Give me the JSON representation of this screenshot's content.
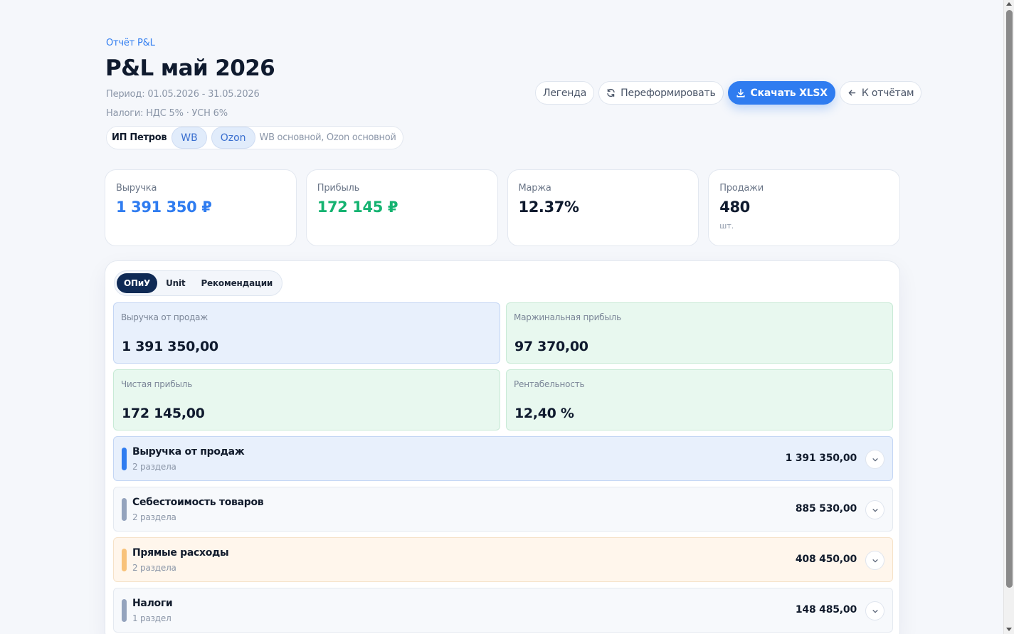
{
  "breadcrumb": "Отчёт P&L",
  "title": "P&L май 2026",
  "period": "Период: 01.05.2026 - 31.05.2026",
  "taxes": "Налоги: НДС 5% · УСН 6%",
  "entity": {
    "name": "ИП Петров",
    "chips": [
      "WB",
      "Ozon"
    ],
    "accounts": "WB основной, Ozon основной"
  },
  "actions": {
    "legend": "Легенда",
    "reform": "Переформировать",
    "download": "Скачать XLSX",
    "back": "К отчётам"
  },
  "kpis": [
    {
      "label": "Выручка",
      "value": "1 391 350 ₽",
      "color": "#2f7cf0"
    },
    {
      "label": "Прибыль",
      "value": "172 145 ₽",
      "color": "#15b371"
    },
    {
      "label": "Маржа",
      "value": "12.37%"
    },
    {
      "label": "Продажи",
      "value": "480",
      "unit": "шт."
    }
  ],
  "tabs": [
    "ОПиУ",
    "Unit",
    "Рекомендации"
  ],
  "active_tab": "ОПиУ",
  "summary": [
    {
      "label": "Выручка от продаж",
      "value": "1 391 350,00"
    },
    {
      "label": "Маржинальная прибыль",
      "value": "97 370,00"
    },
    {
      "label": "Чистая прибыль",
      "value": "172 145,00"
    },
    {
      "label": "Рентабельность",
      "value": "12,40 %"
    }
  ],
  "sections": [
    {
      "title": "Выручка от продаж",
      "subtitle": "2 раздела",
      "value": "1 391 350,00",
      "accent": "#2f7cf0"
    },
    {
      "title": "Себестоимость товаров",
      "subtitle": "2 раздела",
      "value": "885 530,00",
      "accent": "#94a3bd"
    },
    {
      "title": "Прямые расходы",
      "subtitle": "2 раздела",
      "value": "408 450,00",
      "accent": "#f8c27a"
    },
    {
      "title": "Налоги",
      "subtitle": "1 раздел",
      "value": "148 485,00",
      "accent": "#94a3bd"
    }
  ],
  "icons": {
    "reform": "refresh-icon",
    "download": "download-icon",
    "back": "arrow-left-icon",
    "section_toggle": "chevron-down-icon"
  }
}
